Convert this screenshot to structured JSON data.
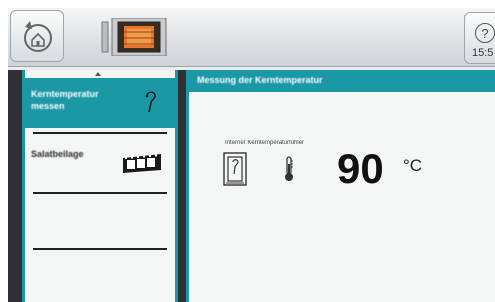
{
  "topbar": {
    "home_icon": "back-home-icon",
    "oven_icon": "oven-icon",
    "help_symbol": "?",
    "clock": "15:5"
  },
  "menu": {
    "scroll_indicator": "up-arrow",
    "items": [
      {
        "label": "Kerntemperatur messen",
        "icon": "core-probe-icon",
        "active": true
      },
      {
        "label": "Salatbeilage",
        "icon": "film-strip-icon",
        "active": false
      },
      {
        "label": "",
        "icon": "",
        "active": false
      },
      {
        "label": "",
        "icon": "",
        "active": false
      }
    ]
  },
  "main": {
    "title": "Messung der Kerntemperatur",
    "probe_label": "Interner Kerntemperaturfühler",
    "temperature_value": "90",
    "temperature_unit": "°C"
  },
  "colors": {
    "accent": "#1b98a6",
    "frame": "#2f3033",
    "panel": "#f4f5f5"
  }
}
